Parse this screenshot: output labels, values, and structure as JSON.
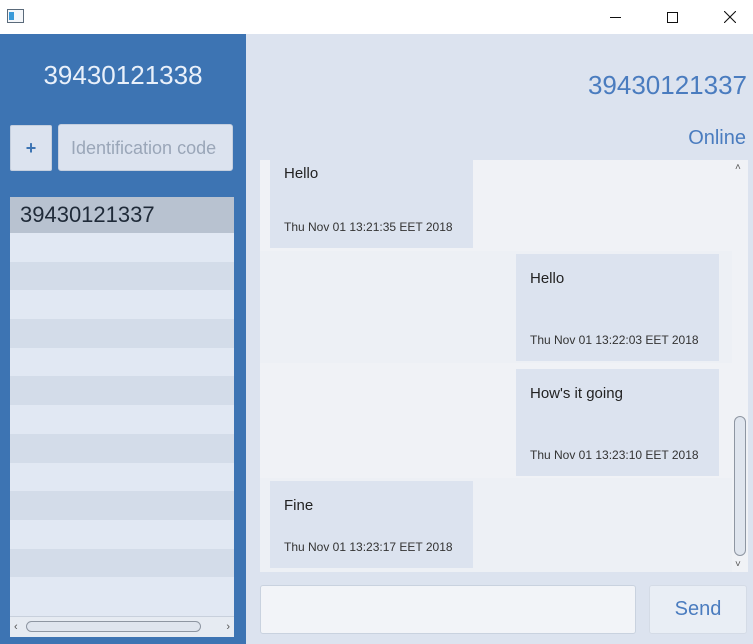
{
  "window": {
    "icon": "app-window-icon",
    "controls": {
      "minimize": "minimize-icon",
      "maximize": "maximize-icon",
      "close": "close-icon"
    }
  },
  "sidebar": {
    "own_id": "39430121338",
    "add_button_label": "+",
    "code_input": {
      "placeholder": "Identification code",
      "value": ""
    },
    "contacts": [
      {
        "label": "39430121337",
        "selected": true
      }
    ],
    "empty_rows": 13
  },
  "chat": {
    "peer_id": "39430121337",
    "status": "Online",
    "messages": [
      {
        "side": "left",
        "text": "Hello",
        "time": "Thu Nov 01 13:21:35 EET 2018"
      },
      {
        "side": "right",
        "text": "Hello",
        "time": "Thu Nov 01 13:22:03 EET 2018"
      },
      {
        "side": "right",
        "text": "How's it going",
        "time": "Thu Nov 01 13:23:10 EET 2018"
      },
      {
        "side": "left",
        "text": "Fine",
        "time": "Thu Nov 01 13:23:17 EET 2018"
      }
    ]
  },
  "compose": {
    "input_value": "",
    "send_label": "Send"
  },
  "colors": {
    "sidebar_bg": "#3d74b3",
    "accent_text": "#4a7cbf",
    "panel_bg": "#dce3ef",
    "bubble_bg": "#dce3ef"
  }
}
